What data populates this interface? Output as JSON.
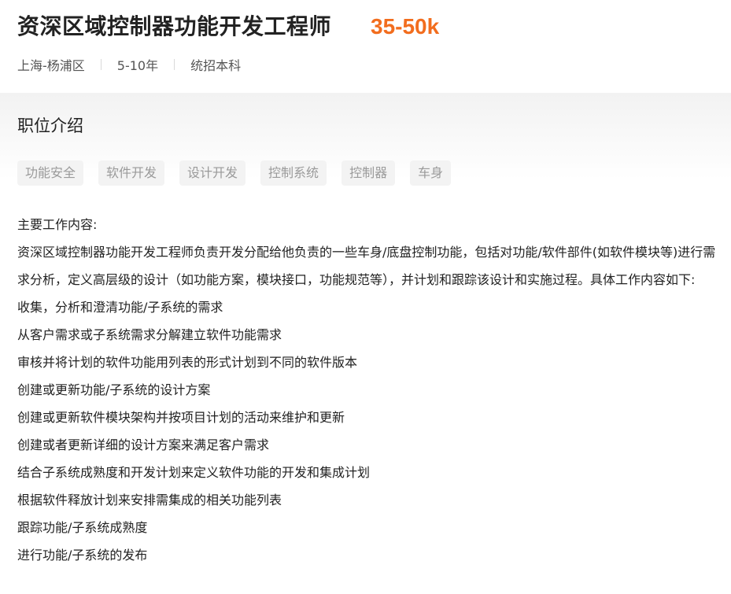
{
  "job": {
    "title": "资深区域控制器功能开发工程师",
    "salary": "35-50k",
    "location": "上海-杨浦区",
    "experience": "5-10年",
    "education": "统招本科"
  },
  "section": {
    "title": "职位介绍"
  },
  "tags": [
    "功能安全",
    "软件开发",
    "设计开发",
    "控制系统",
    "控制器",
    "车身"
  ],
  "description": [
    "主要工作内容:",
    "资深区域控制器功能开发工程师负责开发分配给他负责的一些车身/底盘控制功能，包括对功能/软件部件(如软件模块等)进行需求分析，定义高层级的设计（如功能方案，模块接口，功能规范等），并计划和跟踪该设计和实施过程。具体工作内容如下:",
    "收集，分析和澄清功能/子系统的需求",
    "从客户需求或子系统需求分解建立软件功能需求",
    "审核并将计划的软件功能用列表的形式计划到不同的软件版本",
    "创建或更新功能/子系统的设计方案",
    "创建或更新软件模块架构并按项目计划的活动来维护和更新",
    "创建或者更新详细的设计方案来满足客户需求",
    "结合子系统成熟度和开发计划来定义软件功能的开发和集成计划",
    "根据软件释放计划来安排需集成的相关功能列表",
    "跟踪功能/子系统成熟度",
    "进行功能/子系统的发布"
  ],
  "colors": {
    "salary": "#f26d1e",
    "tag_bg": "#f3f3f3",
    "tag_text": "#9a9a9a"
  }
}
